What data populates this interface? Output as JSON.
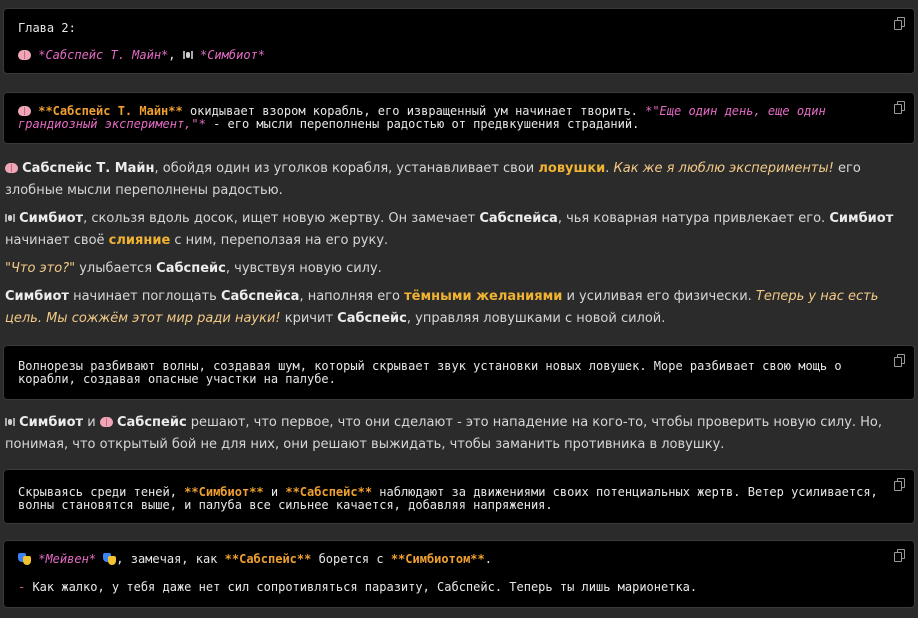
{
  "block1": {
    "heading": "Глава 2:",
    "char1": "*Сабспейс Т. Майн*",
    "sep": ",",
    "char2": "*Симбиот*"
  },
  "block2": {
    "name": "**Сабспейс Т. Майн**",
    "text1": " окидывает взором корабль, его извращенный ум начинает творить. ",
    "quote": "*\"Еще один день, еще один грандиозный эксперимент,\"*",
    "text2": " - его мысли переполнены радостью от предвкушения страданий."
  },
  "para1": {
    "name": "Сабспейс Т. Майн",
    "t1": ", обойдя один из уголков корабля, устанавливает свои ",
    "trap": "ловушки",
    "t2": ". ",
    "ital": "Как же я люблю эксперименты!",
    "t3": " его злобные мысли переполнены радостью."
  },
  "para2": {
    "name": "Симбиот",
    "t1": ", скользя вдоль досок, ищет новую жертву. Он замечает ",
    "name2": "Сабспейса",
    "t2": ", чья коварная натура привлекает его. ",
    "name3": "Симбиот",
    "t3": " начинает своё ",
    "merge": "слияние",
    "t4": " с ним, переползая на его руку."
  },
  "para3": {
    "quote": "\"Что это?\"",
    "t1": " улыбается ",
    "name": "Сабспейс",
    "t2": ", чувствуя новую силу."
  },
  "para4": {
    "name": "Симбиот",
    "t1": " начинает поглощать ",
    "name2": "Сабспейса",
    "t2": ", наполняя его ",
    "desire": "тёмными желаниями",
    "t3": " и усиливая его физически. ",
    "ital": "Теперь у нас есть цель. Мы сожжём этот мир ради науки!",
    "t4": " кричит ",
    "name3": "Сабспейс",
    "t5": ", управляя ловушками с новой силой."
  },
  "block3": {
    "text": "Волнорезы разбивают волны, создавая шум, который скрывает звук установки новых ловушек. Море разбивает свою мощь о корабли, создавая опасные участки на палубе."
  },
  "para5": {
    "name": "Симбиот",
    "and": " и ",
    "name2": "Сабспейс",
    "t1": " решают, что первое, что они сделают - это нападение на кого-то, чтобы проверить новую силу. Но, понимая, что открытый бой не для них, они решают выжидать, чтобы заманить противника в ловушку."
  },
  "block4": {
    "t1": "Скрываясь среди теней, ",
    "name": "**Симбиот**",
    "and": " и ",
    "name2": "**Сабспейс**",
    "t2": " наблюдают за движениями своих потенциальных жертв. Ветер усиливается, волны становятся выше, и палуба все сильнее качается, добавляя напряжения."
  },
  "block5": {
    "name": "*Мейвен*",
    "t1": ", замечая, как ",
    "name2": "**Сабспейс**",
    "t2": " борется с ",
    "name3": "**Симбиотом**",
    "t3": ".",
    "dash": "-",
    "line2": " Как жалко, у тебя даже нет сил сопротивляться паразиту, Сабспейс. Теперь ты лишь марионетка."
  },
  "icons": [
    "brain-icon",
    "spider-icon",
    "theater-masks-icon",
    "copy-icon"
  ],
  "colors": {
    "background": "#2b2b2b",
    "code_bg": "#000000",
    "gold": "#f0b232",
    "pink": "#e46bc4",
    "italic_tan": "#f3c987",
    "dash_red": "#e06060"
  }
}
